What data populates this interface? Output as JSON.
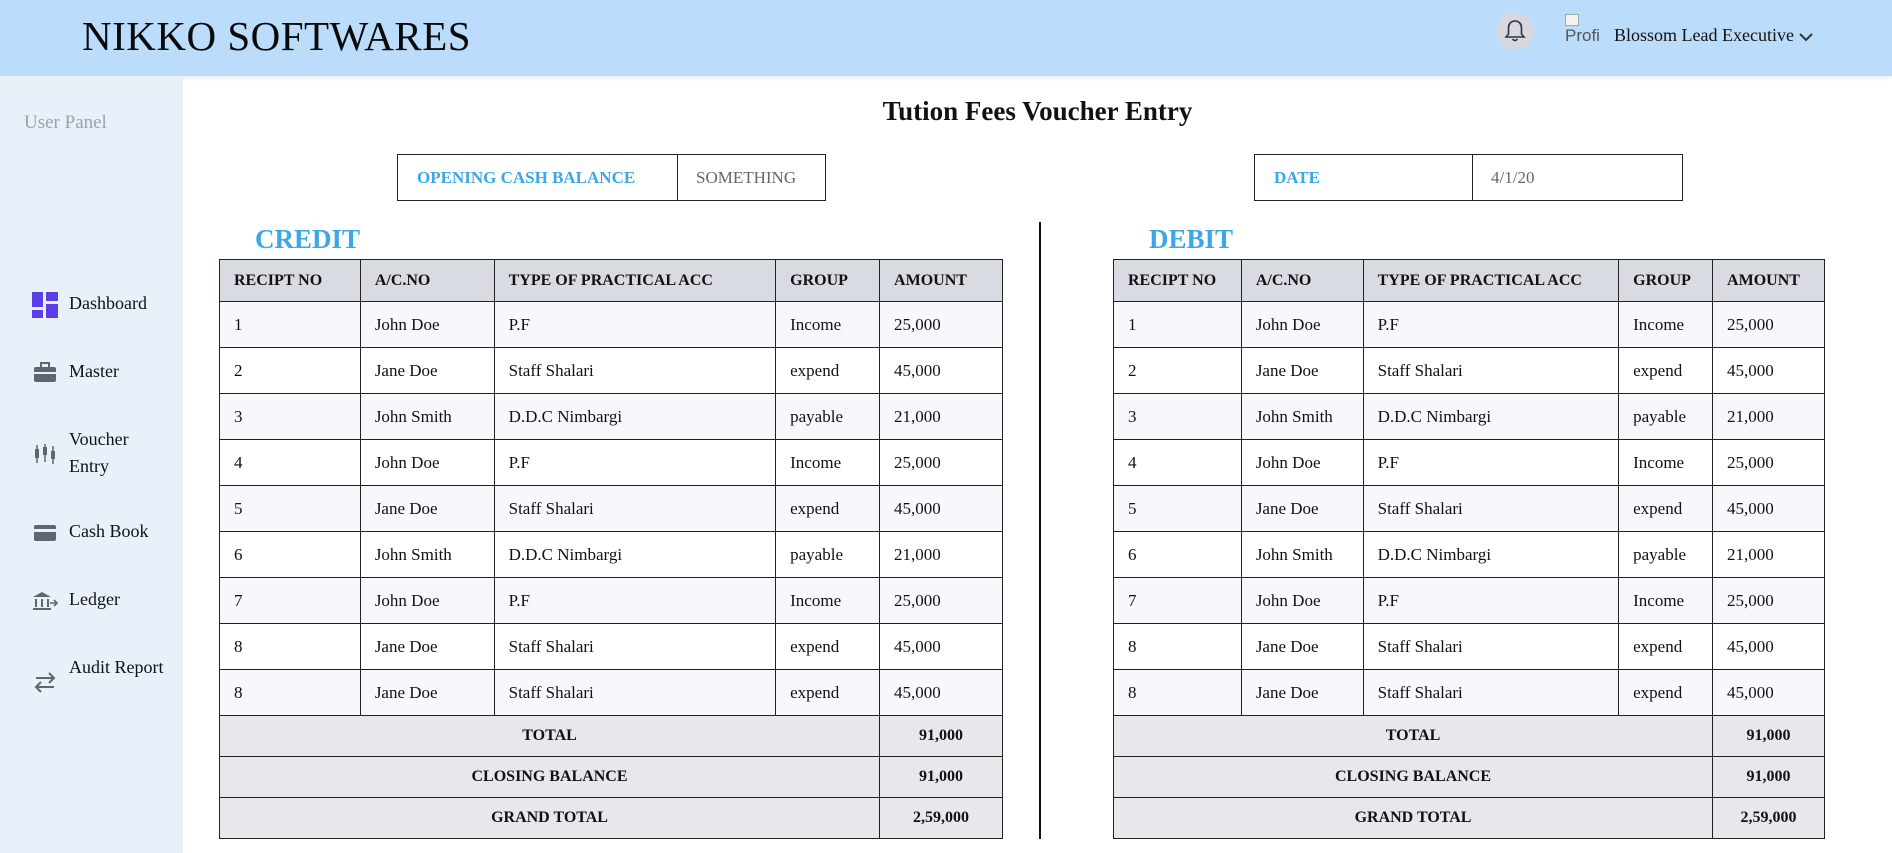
{
  "header": {
    "brand": "NIKKO SOFTWARES",
    "avatar_alt": "Profi",
    "user_name": "Blossom Lead Executive"
  },
  "sidebar": {
    "title": "User Panel",
    "items": [
      {
        "label": "Dashboard",
        "icon": "dashboard-icon"
      },
      {
        "label": "Master",
        "icon": "briefcase-icon"
      },
      {
        "label": "Voucher Entry",
        "icon": "candlestick-icon"
      },
      {
        "label": "Cash Book",
        "icon": "wallet-icon"
      },
      {
        "label": "Ledger",
        "icon": "bank-icon"
      },
      {
        "label": "Audit Report",
        "icon": "transfer-icon"
      }
    ]
  },
  "main": {
    "title": "Tution Fees Voucher Entry",
    "opening_cash": {
      "label": "OPENING CASH BALANCE",
      "value": "SOMETHING"
    },
    "date": {
      "label": "DATE",
      "value": "4/1/20"
    },
    "credit_label": "CREDIT",
    "debit_label": "DEBIT"
  },
  "table": {
    "columns": [
      "RECIPT NO",
      "A/C.NO",
      "TYPE OF PRACTICAL ACC",
      "GROUP",
      "AMOUNT"
    ],
    "rows": [
      [
        "1",
        "John Doe",
        "P.F",
        "Income",
        "25,000"
      ],
      [
        "2",
        "Jane Doe",
        "Staff Shalari",
        "expend",
        "45,000"
      ],
      [
        "3",
        "John Smith",
        "D.D.C Nimbargi",
        "payable",
        "21,000"
      ],
      [
        "4",
        "John Doe",
        "P.F",
        "Income",
        "25,000"
      ],
      [
        "5",
        "Jane Doe",
        "Staff Shalari",
        "expend",
        "45,000"
      ],
      [
        "6",
        "John Smith",
        "D.D.C Nimbargi",
        "payable",
        "21,000"
      ],
      [
        "7",
        "John Doe",
        "P.F",
        "Income",
        "25,000"
      ],
      [
        "8",
        "Jane Doe",
        "Staff Shalari",
        "expend",
        "45,000"
      ],
      [
        "8",
        "Jane Doe",
        "Staff Shalari",
        "expend",
        "45,000"
      ]
    ],
    "footer": [
      {
        "label": "TOTAL",
        "value": "91,000"
      },
      {
        "label": "CLOSING BALANCE",
        "value": "91,000"
      },
      {
        "label": "GRAND TOTAL",
        "value": "2,59,000"
      }
    ]
  },
  "colors": {
    "header_bg": "#bcdcfc",
    "sidebar_bg": "#e8f0f9",
    "accent": "#3ba7e6",
    "dashboard_icon": "#5b3ee8"
  }
}
